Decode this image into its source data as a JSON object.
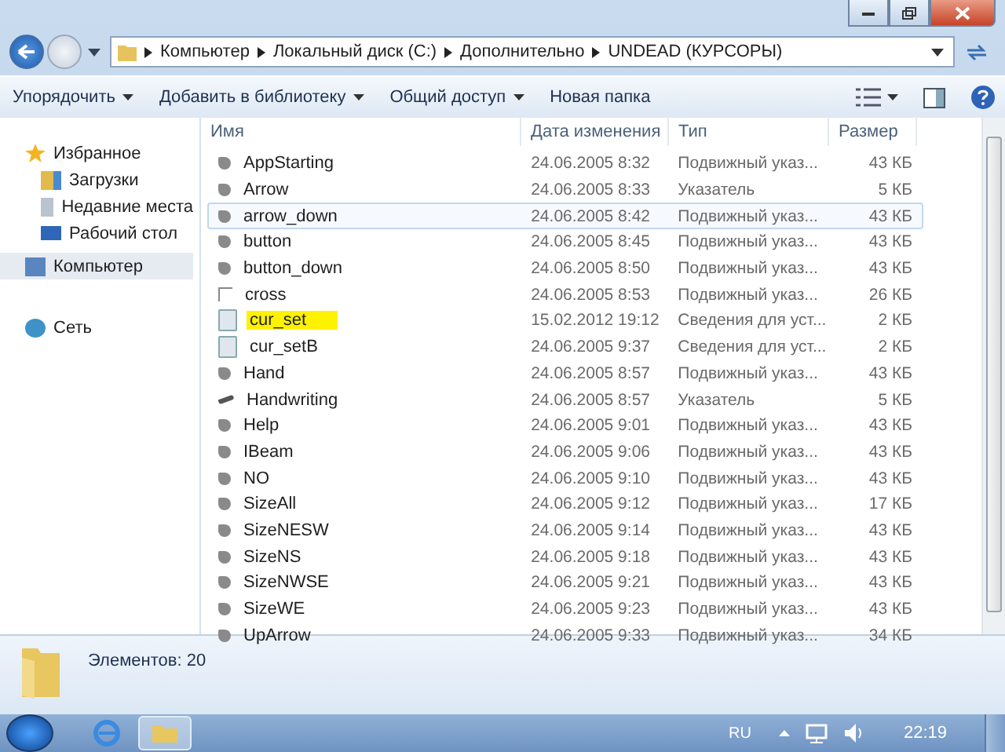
{
  "address": {
    "path": [
      "Компьютер",
      "Локальный диск (C:)",
      "Дополнительно",
      "UNDEAD (КУРСОРЫ)"
    ]
  },
  "toolbar": {
    "items": [
      {
        "label": "Упорядочить",
        "dropdown": true
      },
      {
        "label": "Добавить в библиотеку",
        "dropdown": true
      },
      {
        "label": "Общий доступ",
        "dropdown": true
      },
      {
        "label": "Новая папка",
        "dropdown": false
      }
    ]
  },
  "sidebar": {
    "groups": [
      {
        "label": "Избранное",
        "kind": "star",
        "selected": false,
        "children": [
          {
            "label": "Загрузки",
            "kind": "downloads",
            "selected": false
          },
          {
            "label": "Недавние места",
            "kind": "recent",
            "selected": false
          },
          {
            "label": "Рабочий стол",
            "kind": "desktop",
            "selected": false
          }
        ]
      },
      {
        "label": "Компьютер",
        "kind": "computer",
        "selected": true
      },
      {
        "label": "Сеть",
        "kind": "network",
        "selected": false
      }
    ]
  },
  "table": {
    "columns": [
      "Имя",
      "Дата изменения",
      "Тип",
      "Размер"
    ],
    "rows": [
      {
        "name": "AppStarting",
        "date": "24.06.2005 8:32",
        "type": "Подвижный указ...",
        "size": "43 КБ",
        "kind": "cursor",
        "hovered": false,
        "highlighted": false
      },
      {
        "name": "Arrow",
        "date": "24.06.2005 8:33",
        "type": "Указатель",
        "size": "5 КБ",
        "kind": "cursor",
        "hovered": false,
        "highlighted": false
      },
      {
        "name": "arrow_down",
        "date": "24.06.2005 8:42",
        "type": "Подвижный указ...",
        "size": "43 КБ",
        "kind": "cursor",
        "hovered": true,
        "highlighted": false
      },
      {
        "name": "button",
        "date": "24.06.2005 8:45",
        "type": "Подвижный указ...",
        "size": "43 КБ",
        "kind": "cursor",
        "hovered": false,
        "highlighted": false
      },
      {
        "name": "button_down",
        "date": "24.06.2005 8:50",
        "type": "Подвижный указ...",
        "size": "43 КБ",
        "kind": "cursor",
        "hovered": false,
        "highlighted": false
      },
      {
        "name": "cross",
        "date": "24.06.2005 8:53",
        "type": "Подвижный указ...",
        "size": "26 КБ",
        "kind": "cross",
        "hovered": false,
        "highlighted": false
      },
      {
        "name": "cur_set",
        "date": "15.02.2012 19:12",
        "type": "Сведения для уст...",
        "size": "2 КБ",
        "kind": "setup",
        "hovered": false,
        "highlighted": true
      },
      {
        "name": "cur_setB",
        "date": "24.06.2005 9:37",
        "type": "Сведения для уст...",
        "size": "2 КБ",
        "kind": "setup",
        "hovered": false,
        "highlighted": false
      },
      {
        "name": "Hand",
        "date": "24.06.2005 8:57",
        "type": "Подвижный указ...",
        "size": "43 КБ",
        "kind": "cursor",
        "hovered": false,
        "highlighted": false
      },
      {
        "name": "Handwriting",
        "date": "24.06.2005 8:57",
        "type": "Указатель",
        "size": "5 КБ",
        "kind": "pen",
        "hovered": false,
        "highlighted": false
      },
      {
        "name": "Help",
        "date": "24.06.2005 9:01",
        "type": "Подвижный указ...",
        "size": "43 КБ",
        "kind": "cursor",
        "hovered": false,
        "highlighted": false
      },
      {
        "name": "IBeam",
        "date": "24.06.2005 9:06",
        "type": "Подвижный указ...",
        "size": "43 КБ",
        "kind": "cursor",
        "hovered": false,
        "highlighted": false
      },
      {
        "name": "NO",
        "date": "24.06.2005 9:10",
        "type": "Подвижный указ...",
        "size": "43 КБ",
        "kind": "cursor",
        "hovered": false,
        "highlighted": false
      },
      {
        "name": "SizeAll",
        "date": "24.06.2005 9:12",
        "type": "Подвижный указ...",
        "size": "17 КБ",
        "kind": "cursor",
        "hovered": false,
        "highlighted": false
      },
      {
        "name": "SizeNESW",
        "date": "24.06.2005 9:14",
        "type": "Подвижный указ...",
        "size": "43 КБ",
        "kind": "cursor",
        "hovered": false,
        "highlighted": false
      },
      {
        "name": "SizeNS",
        "date": "24.06.2005 9:18",
        "type": "Подвижный указ...",
        "size": "43 КБ",
        "kind": "cursor",
        "hovered": false,
        "highlighted": false
      },
      {
        "name": "SizeNWSE",
        "date": "24.06.2005 9:21",
        "type": "Подвижный указ...",
        "size": "43 КБ",
        "kind": "cursor",
        "hovered": false,
        "highlighted": false
      },
      {
        "name": "SizeWE",
        "date": "24.06.2005 9:23",
        "type": "Подвижный указ...",
        "size": "43 КБ",
        "kind": "cursor",
        "hovered": false,
        "highlighted": false
      },
      {
        "name": "UpArrow",
        "date": "24.06.2005 9:33",
        "type": "Подвижный указ...",
        "size": "34 КБ",
        "kind": "cursor",
        "hovered": false,
        "highlighted": false
      }
    ]
  },
  "status_bar": {
    "text": "Элементов: 20"
  },
  "taskbar": {
    "language": "RU",
    "time": "22:19"
  }
}
